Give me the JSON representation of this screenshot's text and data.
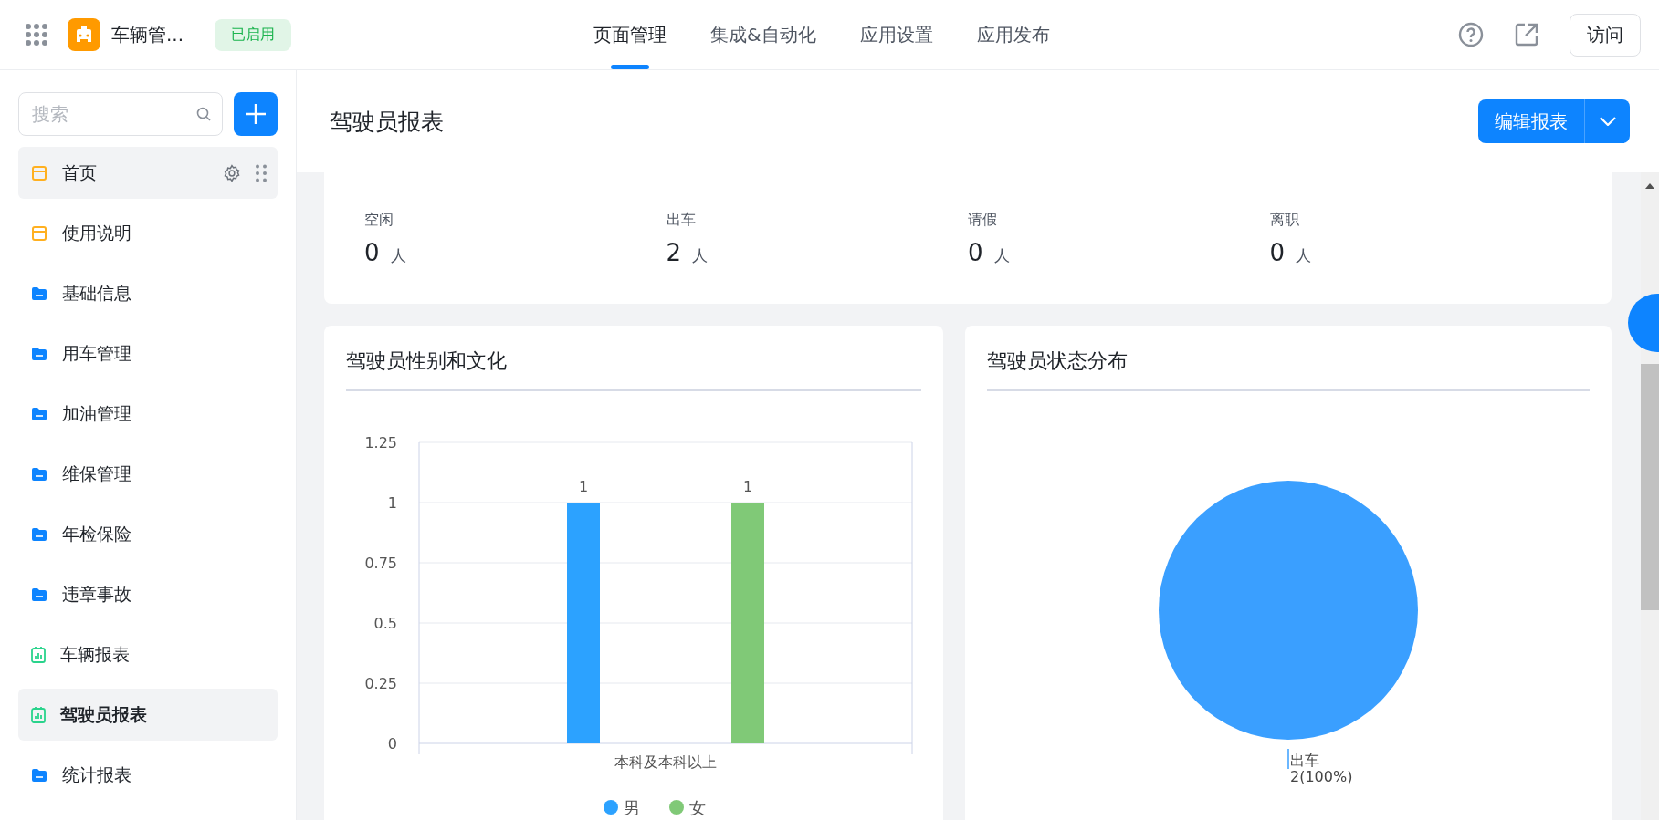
{
  "app": {
    "name": "车辆管...",
    "status": "已启用"
  },
  "nav_tabs": [
    {
      "label": "页面管理",
      "selected": true
    },
    {
      "label": "集成&自动化",
      "selected": false
    },
    {
      "label": "应用设置",
      "selected": false
    },
    {
      "label": "应用发布",
      "selected": false
    }
  ],
  "visit_button": "访问",
  "sidebar": {
    "search": {
      "placeholder": "搜索"
    },
    "items": [
      {
        "label": "首页",
        "kind": "page",
        "selected": false,
        "hovered": true
      },
      {
        "label": "使用说明",
        "kind": "page",
        "selected": false,
        "hovered": false
      },
      {
        "label": "基础信息",
        "kind": "folder",
        "selected": false,
        "hovered": false
      },
      {
        "label": "用车管理",
        "kind": "folder",
        "selected": false,
        "hovered": false
      },
      {
        "label": "加油管理",
        "kind": "folder",
        "selected": false,
        "hovered": false
      },
      {
        "label": "维保管理",
        "kind": "folder",
        "selected": false,
        "hovered": false
      },
      {
        "label": "年检保险",
        "kind": "folder",
        "selected": false,
        "hovered": false
      },
      {
        "label": "违章事故",
        "kind": "folder",
        "selected": false,
        "hovered": false
      },
      {
        "label": "车辆报表",
        "kind": "report",
        "selected": false,
        "hovered": false
      },
      {
        "label": "驾驶员报表",
        "kind": "report",
        "selected": true,
        "hovered": false
      },
      {
        "label": "统计报表",
        "kind": "folder",
        "selected": false,
        "hovered": false
      }
    ]
  },
  "page_title": "驾驶员报表",
  "edit_button": "编辑报表",
  "stats": [
    {
      "label": "空闲",
      "value": "0",
      "unit": "人"
    },
    {
      "label": "出车",
      "value": "2",
      "unit": "人"
    },
    {
      "label": "请假",
      "value": "0",
      "unit": "人"
    },
    {
      "label": "离职",
      "value": "0",
      "unit": "人"
    }
  ],
  "bar_card": {
    "title": "驾驶员性别和文化",
    "chart_data": {
      "type": "bar",
      "categories": [
        "本科及本科以上"
      ],
      "series": [
        {
          "name": "男",
          "color": "#2ca2ff",
          "values": [
            1
          ]
        },
        {
          "name": "女",
          "color": "#80c977",
          "values": [
            1
          ]
        }
      ],
      "grid": true,
      "legend": true,
      "ylim": [
        0,
        1.25
      ],
      "yticks": [
        0,
        {
          "value": 0.25,
          "label": "0.25"
        },
        {
          "value": 0.5,
          "label": "0.5"
        },
        {
          "value": 0.75,
          "label": "0.75"
        },
        1,
        {
          "value": 1.25,
          "label": "1.25"
        }
      ],
      "data_labels": true
    }
  },
  "pie_card": {
    "title": "驾驶员状态分布",
    "chart_data": {
      "type": "pie",
      "categories": [
        "出车"
      ],
      "series": [
        {
          "color": "#3a9fff",
          "values": [
            100
          ]
        }
      ],
      "value_labels": [
        "2(100%)"
      ]
    }
  }
}
